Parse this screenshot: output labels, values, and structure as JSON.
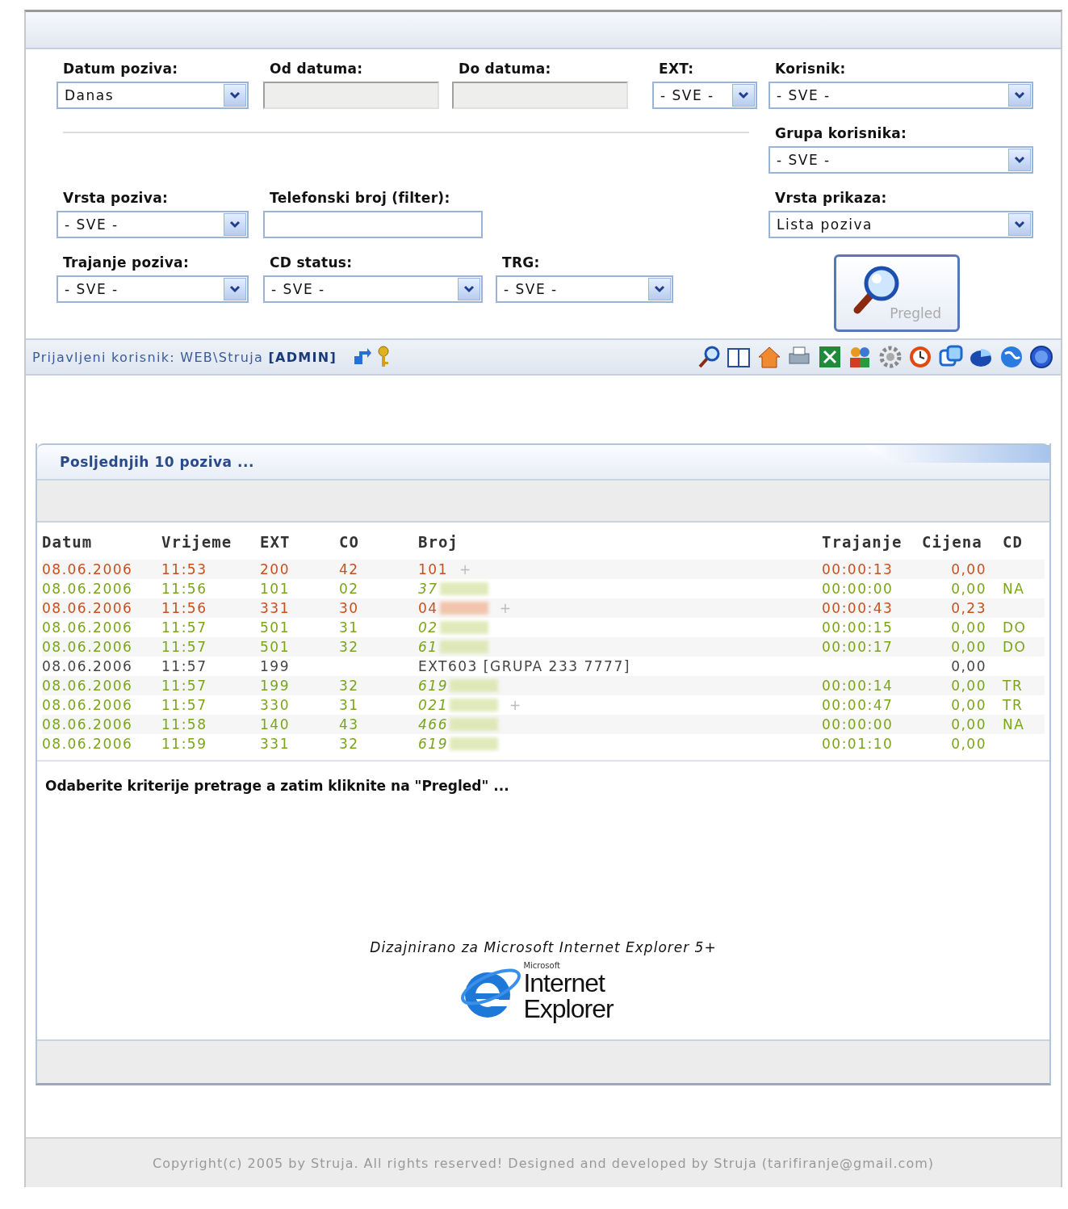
{
  "filters": {
    "left_rows": [
      [
        {
          "label": "Datum poziva:",
          "kind": "select",
          "value": "Danas"
        },
        {
          "label": "Od datuma:",
          "kind": "date"
        },
        {
          "label": "Do datuma:",
          "kind": "date"
        },
        {
          "label": "EXT:",
          "kind": "select",
          "value": "- SVE -"
        }
      ],
      [
        {
          "label": "Vrsta poziva:",
          "kind": "select",
          "value": "- SVE -"
        },
        {
          "label": "Telefonski broj (filter):",
          "kind": "text"
        }
      ],
      [
        {
          "label": "Trajanje poziva:",
          "kind": "select",
          "value": "- SVE -"
        },
        {
          "label": "CD status:",
          "kind": "select",
          "value": "- SVE -"
        },
        {
          "label": "TRG:",
          "kind": "select",
          "value": "- SVE -"
        }
      ]
    ],
    "right": [
      {
        "label": "Korisnik:",
        "kind": "select",
        "value": "- SVE -"
      },
      {
        "label": "Grupa korisnika:",
        "kind": "select",
        "value": "- SVE -"
      },
      {
        "label": "Vrsta prikaza:",
        "kind": "select",
        "value": "Lista poziva"
      }
    ],
    "button": "Pregled"
  },
  "userbar": {
    "label": "Prijavljeni korisnik:",
    "user": "WEB\\Struja",
    "role": "[ADMIN]"
  },
  "panel": {
    "title": "Posljednjih 10 poziva ...",
    "columns": [
      "Datum",
      "Vrijeme",
      "EXT",
      "CO",
      "Broj",
      "Trajanje",
      "Cijena",
      "CD"
    ],
    "rows": [
      {
        "kind": "out",
        "cells": [
          "08.06.2006",
          "11:53",
          "200",
          "42",
          "101",
          "00:00:13",
          "0,00",
          ""
        ],
        "plus": "+"
      },
      {
        "kind": "in",
        "cells": [
          "08.06.2006",
          "11:56",
          "101",
          "02",
          "37",
          "00:00:00",
          "0,00",
          "NA"
        ],
        "blurred": true
      },
      {
        "kind": "out",
        "cells": [
          "08.06.2006",
          "11:56",
          "331",
          "30",
          "04",
          "00:00:43",
          "0,23",
          ""
        ],
        "blurred": true,
        "plus": "+"
      },
      {
        "kind": "in",
        "cells": [
          "08.06.2006",
          "11:57",
          "501",
          "31",
          "02",
          "00:00:15",
          "0,00",
          "DO"
        ],
        "blurred": true
      },
      {
        "kind": "in",
        "cells": [
          "08.06.2006",
          "11:57",
          "501",
          "32",
          "61",
          "00:00:17",
          "0,00",
          "DO"
        ],
        "blurred": true
      },
      {
        "kind": "internal",
        "cells": [
          "08.06.2006",
          "11:57",
          "199",
          "",
          "EXT603 [GRUPA 233 7777]",
          "",
          "0,00",
          ""
        ]
      },
      {
        "kind": "in",
        "cells": [
          "08.06.2006",
          "11:57",
          "199",
          "32",
          "619",
          "00:00:14",
          "0,00",
          "TR"
        ],
        "blurred": true
      },
      {
        "kind": "in",
        "cells": [
          "08.06.2006",
          "11:57",
          "330",
          "31",
          "021",
          "00:00:47",
          "0,00",
          "TR"
        ],
        "blurred": true,
        "plus": "+"
      },
      {
        "kind": "in",
        "cells": [
          "08.06.2006",
          "11:58",
          "140",
          "43",
          "466",
          "00:00:00",
          "0,00",
          "NA"
        ],
        "blurred": true
      },
      {
        "kind": "in",
        "cells": [
          "08.06.2006",
          "11:59",
          "331",
          "32",
          "619",
          "00:01:10",
          "0,00",
          ""
        ],
        "blurred": true
      }
    ],
    "message": "Odaberite kriterije pretrage a zatim kliknite na \"Pregled\" ...",
    "designed_for": "Dizajnirano za Microsoft Internet Explorer 5+",
    "logo": {
      "maker": "Microsoft",
      "line1": "Internet",
      "line2": "Explorer"
    }
  },
  "footer": "Copyright(c) 2005 by Struja. All rights reserved! Designed and developed by Struja (tarifiranje@gmail.com)"
}
